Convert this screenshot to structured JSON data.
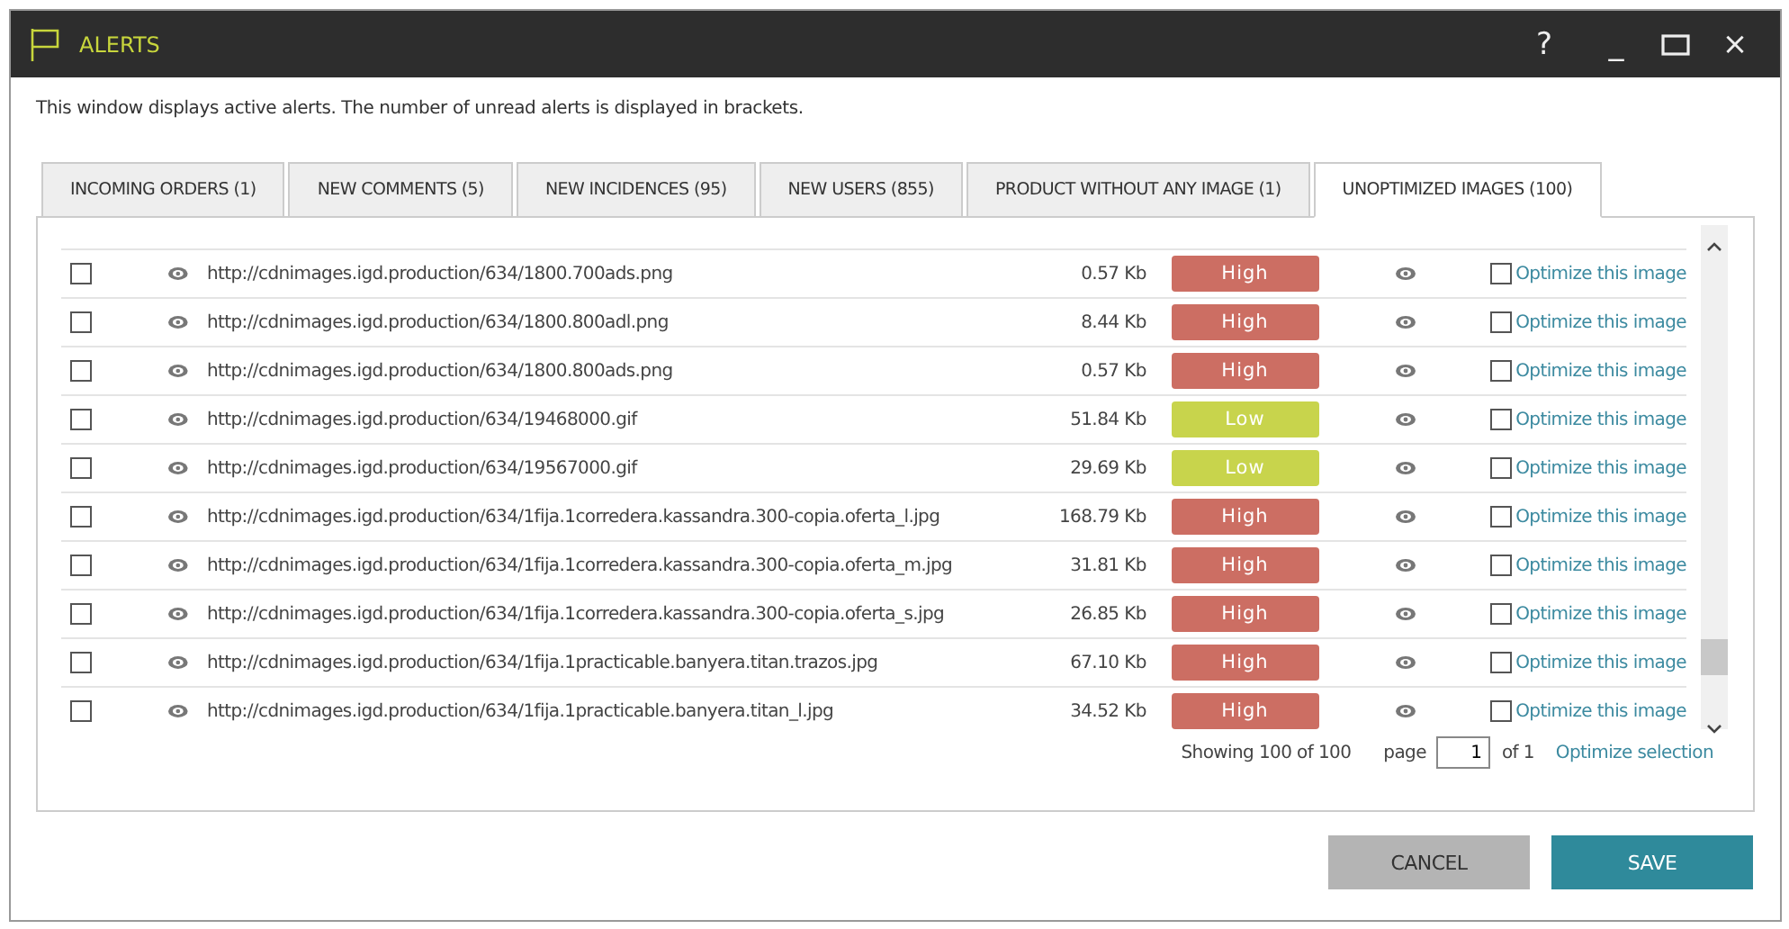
{
  "window": {
    "title": "ALERTS",
    "controls": [
      "?",
      "_",
      "×"
    ]
  },
  "description": "This window displays active alerts. The number of unread alerts is displayed in brackets.",
  "tabs": [
    {
      "label": "INCOMING ORDERS (1)",
      "selected": false
    },
    {
      "label": "NEW COMMENTS (5)",
      "selected": false
    },
    {
      "label": "NEW INCIDENCES (95)",
      "selected": false
    },
    {
      "label": "NEW USERS (855)",
      "selected": false
    },
    {
      "label": "PRODUCT WITHOUT ANY IMAGE (1)",
      "selected": false
    },
    {
      "label": "UNOPTIMIZED IMAGES (100)",
      "selected": true
    }
  ],
  "rows": [
    {
      "checked": false,
      "url": "http://cdnimages.igd.production/634/1800.700ads.png",
      "size": "0.57 Kb",
      "priority": "High",
      "kind": "high",
      "optimize": "Optimize this image",
      "optimize_checked": false
    },
    {
      "checked": false,
      "url": "http://cdnimages.igd.production/634/1800.800adl.png",
      "size": "8.44 Kb",
      "priority": "High",
      "kind": "high",
      "optimize": "Optimize this image",
      "optimize_checked": false
    },
    {
      "checked": false,
      "url": "http://cdnimages.igd.production/634/1800.800ads.png",
      "size": "0.57 Kb",
      "priority": "High",
      "kind": "high",
      "optimize": "Optimize this image",
      "optimize_checked": false
    },
    {
      "checked": false,
      "url": "http://cdnimages.igd.production/634/19468000.gif",
      "size": "51.84 Kb",
      "priority": "Low",
      "kind": "low",
      "optimize": "Optimize this image",
      "optimize_checked": false
    },
    {
      "checked": false,
      "url": "http://cdnimages.igd.production/634/19567000.gif",
      "size": "29.69 Kb",
      "priority": "Low",
      "kind": "low",
      "optimize": "Optimize this image",
      "optimize_checked": false
    },
    {
      "checked": false,
      "url": "http://cdnimages.igd.production/634/1fija.1corredera.kassandra.300-copia.oferta_l.jpg",
      "size": "168.79 Kb",
      "priority": "High",
      "kind": "high",
      "optimize": "Optimize this image",
      "optimize_checked": false
    },
    {
      "checked": false,
      "url": "http://cdnimages.igd.production/634/1fija.1corredera.kassandra.300-copia.oferta_m.jpg",
      "size": "31.81 Kb",
      "priority": "High",
      "kind": "high",
      "optimize": "Optimize this image",
      "optimize_checked": false
    },
    {
      "checked": false,
      "url": "http://cdnimages.igd.production/634/1fija.1corredera.kassandra.300-copia.oferta_s.jpg",
      "size": "26.85 Kb",
      "priority": "High",
      "kind": "high",
      "optimize": "Optimize this image",
      "optimize_checked": false
    },
    {
      "checked": false,
      "url": "http://cdnimages.igd.production/634/1fija.1practicable.banyera.titan.trazos.jpg",
      "size": "67.10 Kb",
      "priority": "High",
      "kind": "high",
      "optimize": "Optimize this image",
      "optimize_checked": false
    },
    {
      "checked": false,
      "url": "http://cdnimages.igd.production/634/1fija.1practicable.banyera.titan_l.jpg",
      "size": "34.52 Kb",
      "priority": "High",
      "kind": "high",
      "optimize": "Optimize this image",
      "optimize_checked": false
    }
  ],
  "footer": {
    "showing": "Showing 100 of 100",
    "page_label": "page",
    "page_value": "1",
    "page_total": "of 1",
    "optimize_selection": "Optimize selection"
  },
  "buttons": [
    {
      "label": "CANCEL",
      "kind": "secondary"
    },
    {
      "label": "SAVE",
      "kind": "primary"
    }
  ]
}
